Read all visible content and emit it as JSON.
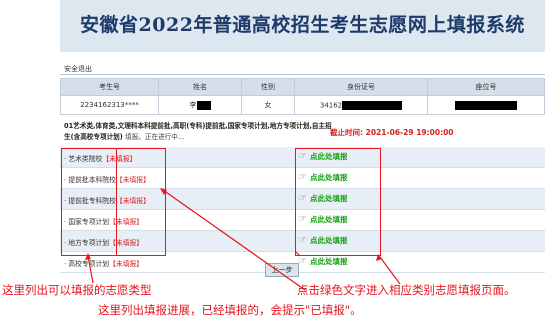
{
  "page_title": "安徽省2022年普通高校招生考生志愿网上填报系统",
  "safe_logout": "安全退出",
  "table": {
    "headers": [
      "考生号",
      "姓名",
      "性别",
      "身份证号",
      "座位号"
    ],
    "row": {
      "exam_no": "2234162313****",
      "name_prefix": "李",
      "gender": "女",
      "id_prefix": "34162",
      "seat_no": ""
    }
  },
  "instructions": {
    "categories_text": "01艺术类,体育类,文理科本科提前批,高职(专科)提前批,国家专项计划,地方专项计划,自主招生(含高校专项计划)",
    "status_text": "填报。正在进行中..."
  },
  "deadline": {
    "label": "截止时间:",
    "value": "2021-06-29 19:00:00"
  },
  "categories": [
    {
      "label": "艺术类院校",
      "status": "【未填报】",
      "action": "点此处填报"
    },
    {
      "label": "提前批本科院校",
      "status": "【未填报】",
      "action": "点此处填报"
    },
    {
      "label": "提前批专科院校",
      "status": "【未填报】",
      "action": "点此处填报"
    },
    {
      "label": "国家专项计划",
      "status": "【未填报】",
      "action": "点此处填报"
    },
    {
      "label": "地方专项计划",
      "status": "【未填报】",
      "action": "点此处填报"
    },
    {
      "label": "高校专项计划",
      "status": "【未填报】",
      "action": "点此处填报"
    }
  ],
  "prev_button": "上一步",
  "annotations": {
    "left": "这里列出可以填报的志愿类型",
    "right": "点击绿色文字进入相应类别志愿填报页面。",
    "bottom": "这里列出填报进展，已经填报的，会提示\"已填报\"。"
  },
  "colors": {
    "annotation_red": "#e6141e",
    "action_green": "#18a018",
    "title_blue": "#1e3a6a"
  }
}
